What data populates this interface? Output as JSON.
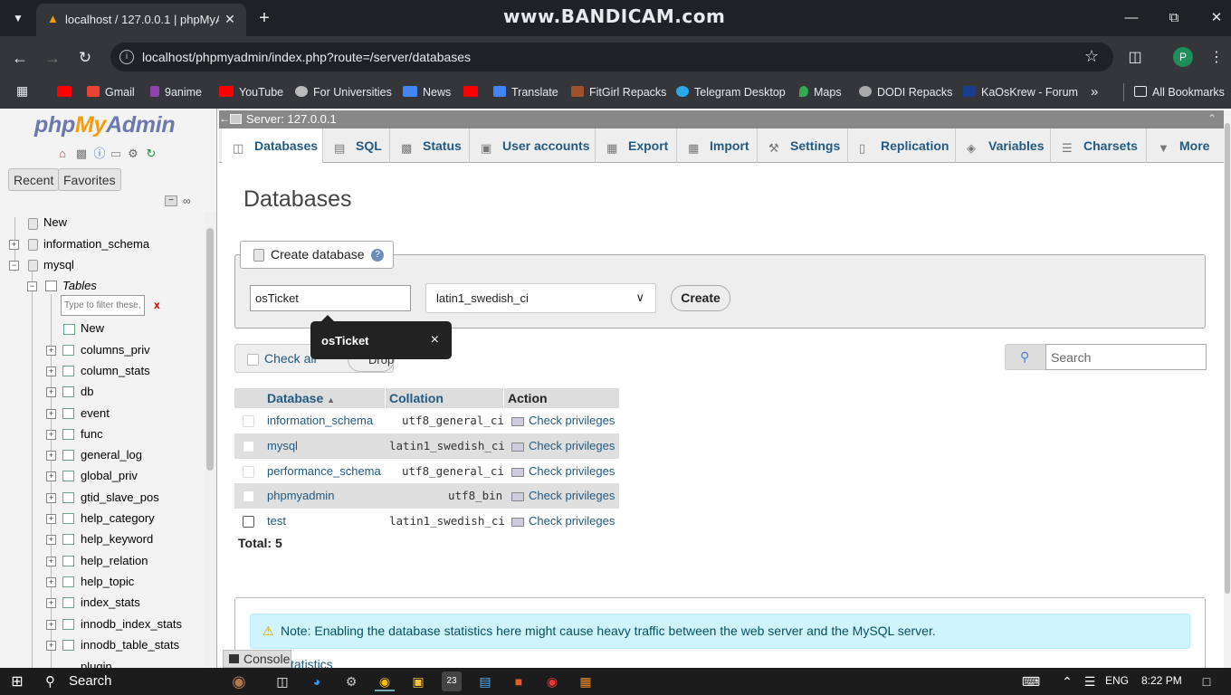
{
  "browser": {
    "tab_title": "localhost / 127.0.0.1 | phpMyAd",
    "watermark": "www.BANDICAM.com",
    "url": "localhost/phpmyadmin/index.php?route=/server/databases",
    "profile_initial": "P",
    "bookmarks": [
      "Gmail",
      "9anime",
      "YouTube",
      "For Universities",
      "News",
      "Translate",
      "FitGirl Repacks",
      "Telegram Desktop",
      "Maps",
      "DODI Repacks",
      "KaOsKrew - Forum"
    ],
    "all_bookmarks": "All Bookmarks"
  },
  "sidebar": {
    "logo": {
      "php": "php",
      "my": "My",
      "admin": "Admin"
    },
    "recent": "Recent",
    "favorites": "Favorites",
    "new_db": "New",
    "db1": "information_schema",
    "db2": "mysql",
    "tables_node": "Tables",
    "filter_placeholder": "Type to filter these, E",
    "filter_clear": "x",
    "new_table": "New",
    "tables": [
      "columns_priv",
      "column_stats",
      "db",
      "event",
      "func",
      "general_log",
      "global_priv",
      "gtid_slave_pos",
      "help_category",
      "help_keyword",
      "help_relation",
      "help_topic",
      "index_stats",
      "innodb_index_stats",
      "innodb_table_stats",
      "plugin"
    ]
  },
  "server_bar": "Server: 127.0.0.1",
  "tabs": [
    "Databases",
    "SQL",
    "Status",
    "User accounts",
    "Export",
    "Import",
    "Settings",
    "Replication",
    "Variables",
    "Charsets",
    "More"
  ],
  "page_title": "Databases",
  "create_db": {
    "legend": "Create database",
    "name_value": "osTicket",
    "collation": "latin1_swedish_ci",
    "button": "Create",
    "tooltip": "osTicket",
    "tooltip_close": "×"
  },
  "check_all": "Check all",
  "drop_label": "Drop",
  "search_placeholder": "Search",
  "table": {
    "headers": [
      "Database",
      "Collation",
      "Action"
    ],
    "rows": [
      {
        "name": "information_schema",
        "collation": "utf8_general_ci",
        "action": "Check privileges"
      },
      {
        "name": "mysql",
        "collation": "latin1_swedish_ci",
        "action": "Check privileges"
      },
      {
        "name": "performance_schema",
        "collation": "utf8_general_ci",
        "action": "Check privileges"
      },
      {
        "name": "phpmyadmin",
        "collation": "utf8_bin",
        "action": "Check privileges"
      },
      {
        "name": "test",
        "collation": "latin1_swedish_ci",
        "action": "Check privileges"
      }
    ],
    "total": "Total: 5"
  },
  "notice": "Note: Enabling the database statistics here might cause heavy traffic between the web server and the MySQL server.",
  "stats_link": "statistics",
  "console": "Console",
  "taskbar": {
    "search": "Search",
    "lang": "ENG",
    "time": "8:22 PM"
  }
}
